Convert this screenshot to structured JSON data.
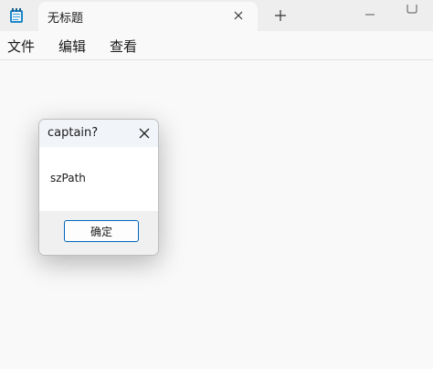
{
  "tab": {
    "title": "无标题"
  },
  "menu": {
    "items": [
      "文件",
      "编辑",
      "查看"
    ]
  },
  "dialog": {
    "title": "captain?",
    "message": "szPath",
    "ok_label": "确定"
  },
  "icons": {
    "app": "notepad-icon",
    "tab_close": "close-icon",
    "new_tab": "plus-icon",
    "minimize": "minimize-icon",
    "maximize": "maximize-icon",
    "dialog_close": "close-icon"
  },
  "colors": {
    "accent": "#0067c0",
    "app_icon": "#1e88c9"
  }
}
